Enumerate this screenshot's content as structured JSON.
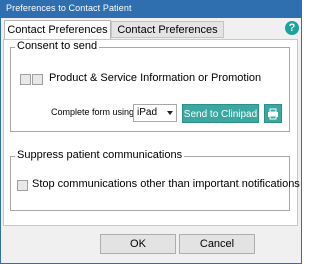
{
  "window": {
    "title": "Preferences to Contact Patient"
  },
  "tabs": [
    {
      "label": "Contact Preferences"
    },
    {
      "label": "Contact Preferences Audit"
    }
  ],
  "help": {
    "glyph": "?"
  },
  "consent": {
    "heading": "Consent to send",
    "product_label": "Product & Service Information or Promotion",
    "complete_form_label": "Complete form using",
    "device_value": "iPad",
    "send_button": "Send to Clinipad"
  },
  "suppress": {
    "heading": "Suppress patient communications",
    "stop_label": "Stop communications other than important notifications"
  },
  "footer": {
    "ok": "OK",
    "cancel": "Cancel"
  },
  "colors": {
    "titlebar": "#2f6fb0",
    "accent_button": "#3aa8a0",
    "help": "#1ba3a0"
  },
  "icons": {
    "print": "printer-icon",
    "help": "help-icon"
  }
}
